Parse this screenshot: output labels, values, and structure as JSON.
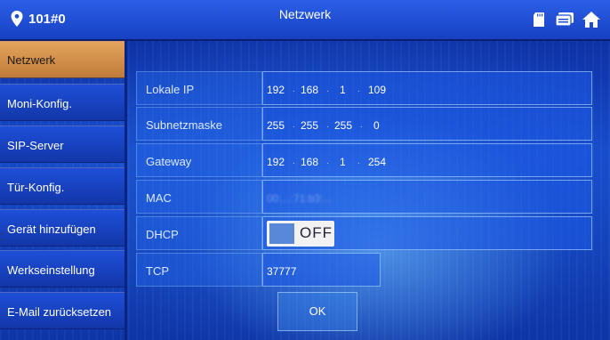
{
  "header": {
    "room_id": "101#0",
    "title": "Netzwerk",
    "icons": [
      "location-pin-icon",
      "sd-card-icon",
      "message-icon",
      "home-icon"
    ]
  },
  "sidebar": {
    "items": [
      {
        "label": "Netzwerk",
        "active": true
      },
      {
        "label": "Moni-Konfig.",
        "active": false
      },
      {
        "label": "SIP-Server",
        "active": false
      },
      {
        "label": "Tür-Konfig.",
        "active": false
      },
      {
        "label": "Gerät hinzufügen",
        "active": false
      },
      {
        "label": "Werkseinstellung",
        "active": false
      },
      {
        "label": "E-Mail zurücksetzen",
        "active": false
      }
    ]
  },
  "form": {
    "local_ip": {
      "label": "Lokale IP",
      "octets": [
        "192",
        "168",
        "1",
        "109"
      ]
    },
    "subnet": {
      "label": "Subnetzmaske",
      "octets": [
        "255",
        "255",
        "255",
        "0"
      ]
    },
    "gateway": {
      "label": "Gateway",
      "octets": [
        "192",
        "168",
        "1",
        "254"
      ]
    },
    "mac": {
      "label": "MAC",
      "value": "00:...:71:b3:..."
    },
    "dhcp": {
      "label": "DHCP",
      "state": "OFF"
    },
    "tcp": {
      "label": "TCP",
      "value": "37777"
    }
  },
  "actions": {
    "ok_label": "OK"
  },
  "colors": {
    "active_tab": "#e4a45c",
    "background": "#1548c8",
    "topbar": "#2b5ee8"
  }
}
